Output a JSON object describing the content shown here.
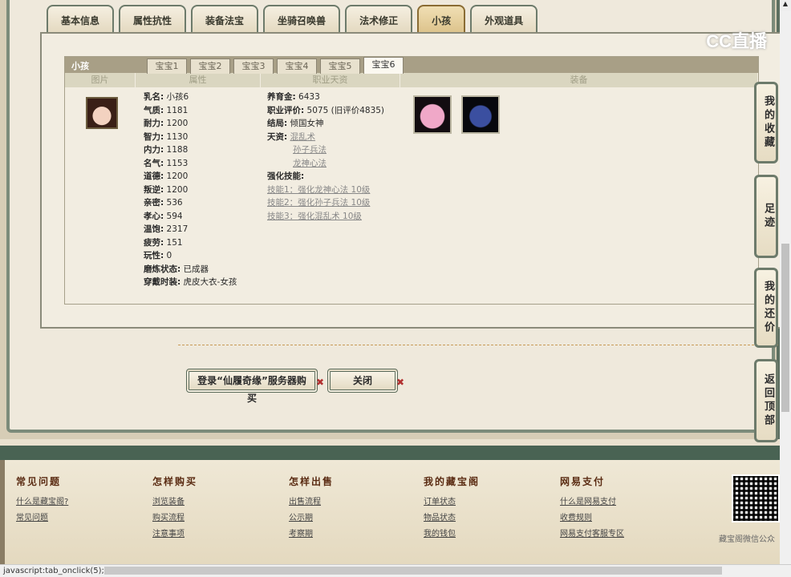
{
  "tabs": [
    {
      "label": "基本信息"
    },
    {
      "label": "属性抗性"
    },
    {
      "label": "装备法宝"
    },
    {
      "label": "坐骑召唤兽"
    },
    {
      "label": "法术修正"
    },
    {
      "label": "小孩"
    },
    {
      "label": "外观道具"
    }
  ],
  "active_tab": "小孩",
  "logo": "CC直播",
  "panel": {
    "title": "小孩",
    "subtabs": [
      "宝宝1",
      "宝宝2",
      "宝宝3",
      "宝宝4",
      "宝宝5",
      "宝宝6"
    ],
    "active_subtab": "宝宝6",
    "columns": [
      "图片",
      "属性",
      "职业天资",
      "装备"
    ]
  },
  "attributes": [
    {
      "k": "乳名:",
      "v": "小孩6"
    },
    {
      "k": "气质:",
      "v": "1181"
    },
    {
      "k": "耐力:",
      "v": "1200"
    },
    {
      "k": "智力:",
      "v": "1130"
    },
    {
      "k": "内力:",
      "v": "1188"
    },
    {
      "k": "名气:",
      "v": "1153"
    },
    {
      "k": "道德:",
      "v": "1200"
    },
    {
      "k": "叛逆:",
      "v": "1200"
    },
    {
      "k": "亲密:",
      "v": "536"
    },
    {
      "k": "孝心:",
      "v": "594"
    },
    {
      "k": "温饱:",
      "v": "2317"
    },
    {
      "k": "疲劳:",
      "v": "151"
    },
    {
      "k": "玩性:",
      "v": "0"
    },
    {
      "k": "磨炼状态:",
      "v": "已成器"
    },
    {
      "k": "穿戴时装:",
      "v": "虎皮大衣-女孩"
    }
  ],
  "career": {
    "fund_label": "养育金:",
    "fund": "6433",
    "rating_label": "职业评价:",
    "rating": "5075 (旧评价4835)",
    "ending_label": "结局:",
    "ending": "倾国女神",
    "talent_label": "天资:",
    "talents": [
      "混乱术",
      "孙子兵法",
      "龙神心法"
    ],
    "skills_label": "强化技能:",
    "skills": [
      "技能1：强化龙神心法 10级",
      "技能2：强化孙子兵法 10级",
      "技能3：强化混乱术 10级"
    ]
  },
  "buttons": {
    "buy": "登录“仙履奇缘”服务器购买",
    "close": "关闭"
  },
  "side_nav": {
    "fav": "我的收藏",
    "track": "足迹",
    "bargain": "我的还价",
    "top": "返回顶部"
  },
  "footer": {
    "cols": [
      {
        "title": "常见问题",
        "links": [
          "什么是藏宝阁?",
          "常见问题"
        ]
      },
      {
        "title": "怎样购买",
        "links": [
          "浏览装备",
          "购买流程",
          "注意事项"
        ]
      },
      {
        "title": "怎样出售",
        "links": [
          "出售流程",
          "公示期",
          "考察期"
        ]
      },
      {
        "title": "我的藏宝阁",
        "links": [
          "订单状态",
          "物品状态",
          "我的钱包"
        ]
      },
      {
        "title": "网易支付",
        "links": [
          "什么是网易支付",
          "收费规则",
          "网易支付客服专区"
        ]
      }
    ],
    "qr_caption": "藏宝阁微信公众"
  },
  "status_text": "javascript:tab_onclick(5);"
}
